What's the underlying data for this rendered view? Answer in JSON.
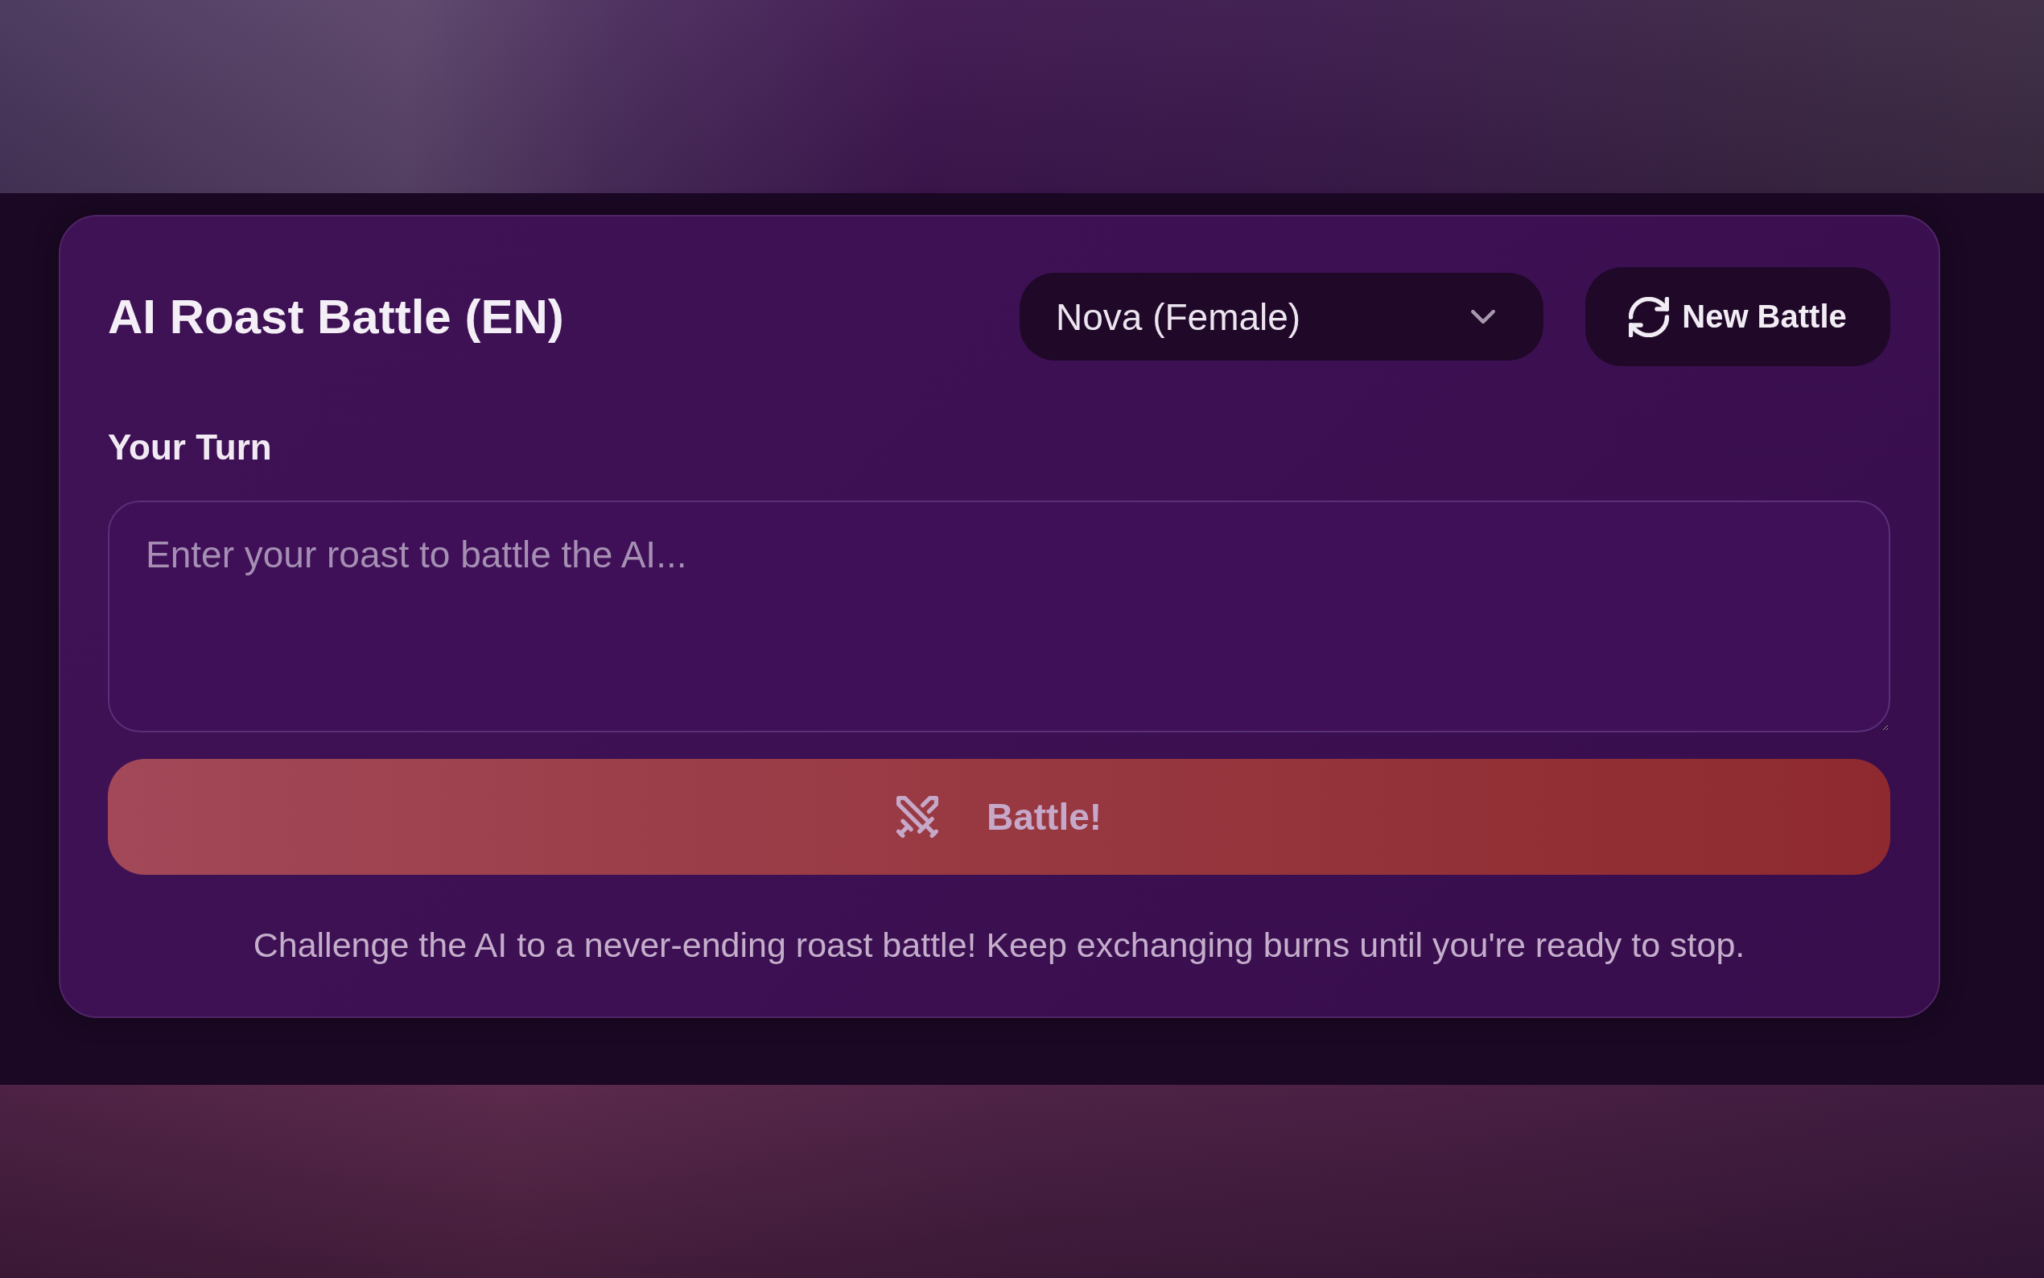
{
  "title": "AI Roast Battle (EN)",
  "voice_select": {
    "value": "Nova (Female)"
  },
  "new_battle_button": {
    "label": "New Battle"
  },
  "prompt": {
    "label": "Your Turn",
    "placeholder": "Enter your roast to battle the AI..."
  },
  "battle_button": {
    "label": "Battle!",
    "disabled": true
  },
  "hint": "Challenge the AI to a never-ending roast battle! Keep exchanging burns until you're ready to stop."
}
